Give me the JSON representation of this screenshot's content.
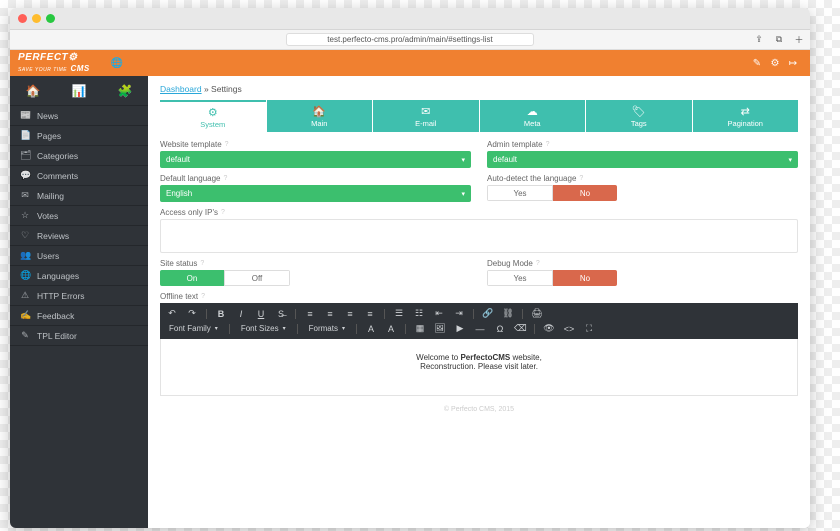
{
  "browser": {
    "url": "test.perfecto-cms.pro/admin/main/#settings-list"
  },
  "header": {
    "brand_top": "PERFECT",
    "brand_sub": "SAVE YOUR TIME",
    "brand_suffix": "CMS"
  },
  "breadcrumb": {
    "root": "Dashboard",
    "sep": " » ",
    "current": "Settings"
  },
  "sidebar": {
    "items": [
      {
        "label": "News"
      },
      {
        "label": "Pages"
      },
      {
        "label": "Categories"
      },
      {
        "label": "Comments"
      },
      {
        "label": "Mailing"
      },
      {
        "label": "Votes"
      },
      {
        "label": "Reviews"
      },
      {
        "label": "Users"
      },
      {
        "label": "Languages"
      },
      {
        "label": "HTTP Errors"
      },
      {
        "label": "Feedback"
      },
      {
        "label": "TPL Editor"
      }
    ]
  },
  "tabs": [
    {
      "label": "System"
    },
    {
      "label": "Main"
    },
    {
      "label": "E-mail"
    },
    {
      "label": "Meta"
    },
    {
      "label": "Tags"
    },
    {
      "label": "Pagination"
    }
  ],
  "form": {
    "website_template": {
      "label": "Website template",
      "value": "default"
    },
    "admin_template": {
      "label": "Admin template",
      "value": "default"
    },
    "default_language": {
      "label": "Default language",
      "value": "English"
    },
    "autodetect_lang": {
      "label": "Auto-detect the language",
      "yes": "Yes",
      "no": "No",
      "value": "No"
    },
    "access_ips": {
      "label": "Access only IP's"
    },
    "site_status": {
      "label": "Site status",
      "on": "On",
      "off": "Off",
      "value": "On"
    },
    "debug_mode": {
      "label": "Debug Mode",
      "yes": "Yes",
      "no": "No",
      "value": "No"
    },
    "offline_text": {
      "label": "Offline text"
    }
  },
  "editor": {
    "font_family": "Font Family",
    "font_sizes": "Font Sizes",
    "formats": "Formats",
    "body_pre": "Welcome to ",
    "body_bold": "PerfectoCMS",
    "body_post": " website,",
    "body_line2": "Reconstruction. Please visit later."
  },
  "footer": {
    "copyright": "© Perfecto CMS, 2015"
  }
}
